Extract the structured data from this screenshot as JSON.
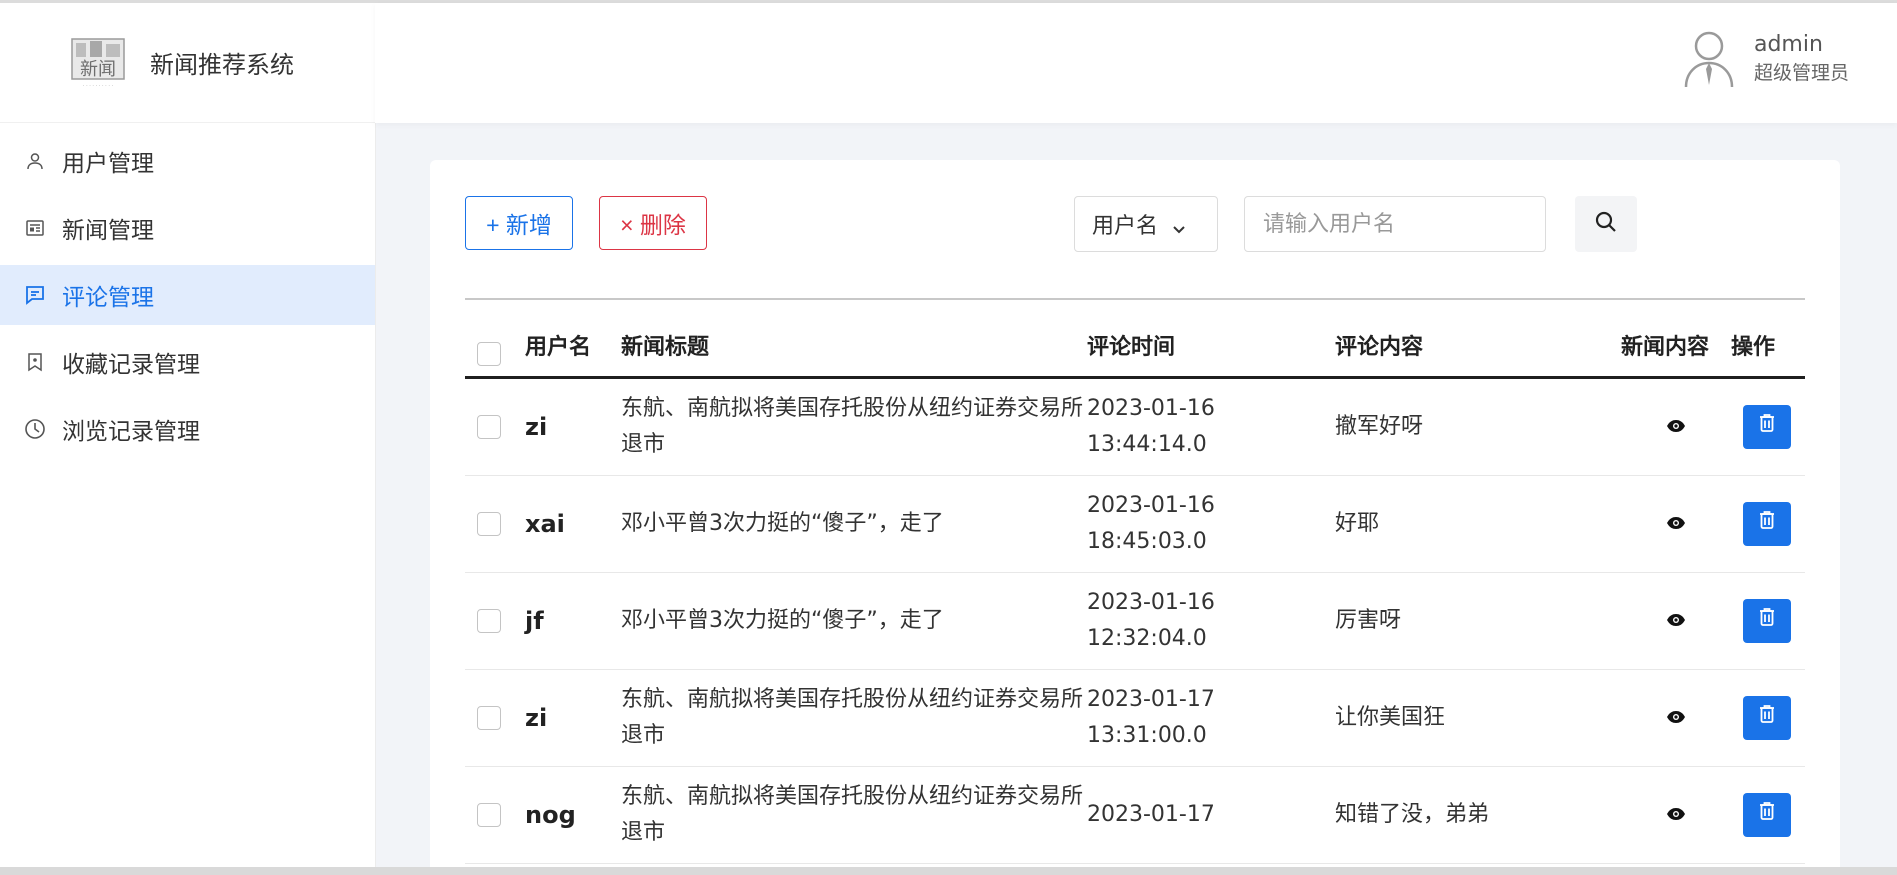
{
  "app": {
    "title": "新闻推荐系统",
    "logo_text": "新闻"
  },
  "user": {
    "name": "admin",
    "role": "超级管理员"
  },
  "sidebar": {
    "items": [
      {
        "label": "用户管理",
        "icon": "user-icon",
        "active": false
      },
      {
        "label": "新闻管理",
        "icon": "newspaper-icon",
        "active": false
      },
      {
        "label": "评论管理",
        "icon": "comment-icon",
        "active": true
      },
      {
        "label": "收藏记录管理",
        "icon": "bookmark-icon",
        "active": false
      },
      {
        "label": "浏览记录管理",
        "icon": "clock-icon",
        "active": false
      }
    ]
  },
  "toolbar": {
    "add_label": "+ 新增",
    "delete_label": "× 删除",
    "filter_selected": "用户名",
    "search_placeholder": "请输入用户名"
  },
  "table": {
    "headers": {
      "username": "用户名",
      "title": "新闻标题",
      "time": "评论时间",
      "content": "评论内容",
      "news_content": "新闻内容",
      "action": "操作"
    },
    "rows": [
      {
        "username": "zi",
        "title": "东航、南航拟将美国存托股份从纽约证券交易所退市",
        "time": "2023-01-16 13:44:14.0",
        "content": "撤军好呀"
      },
      {
        "username": "xai",
        "title": "邓小平曾3次力挺的“傻子”，走了",
        "time": "2023-01-16 18:45:03.0",
        "content": "好耶"
      },
      {
        "username": "jf",
        "title": "邓小平曾3次力挺的“傻子”，走了",
        "time": "2023-01-16 12:32:04.0",
        "content": "厉害呀"
      },
      {
        "username": "zi",
        "title": "东航、南航拟将美国存托股份从纽约证券交易所退市",
        "time": "2023-01-17 13:31:00.0",
        "content": "让你美国狂"
      },
      {
        "username": "nog",
        "title": "东航、南航拟将美国存托股份从纽约证券交易所退市",
        "time": "2023-01-17",
        "content": "知错了没，弟弟"
      }
    ]
  },
  "colors": {
    "primary": "#1a73e8",
    "danger": "#dc3545",
    "active_bg": "#e1ecfd"
  }
}
